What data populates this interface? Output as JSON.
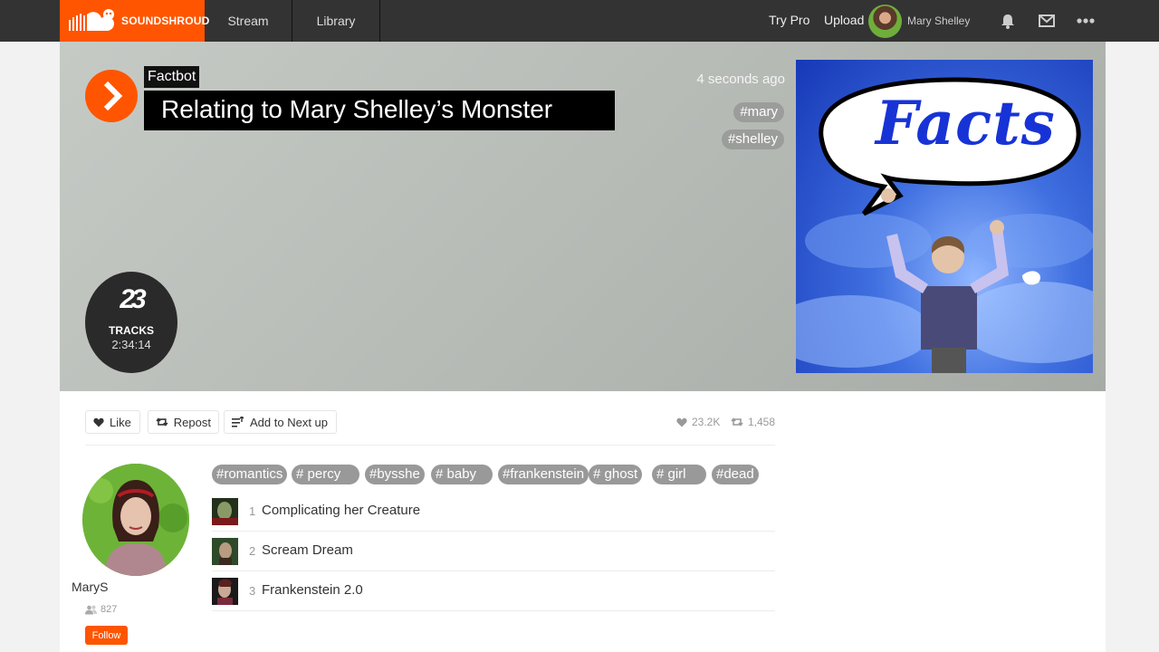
{
  "nav": {
    "logo_text": "SOUNDSHROUD",
    "tabs": [
      {
        "label": "Stream"
      },
      {
        "label": "Library"
      }
    ],
    "try_pro": "Try Pro",
    "upload": "Upload",
    "user_name": "Mary Shelley",
    "icons": [
      "bell-icon",
      "mail-icon",
      "more-icon"
    ],
    "accent": "#ff5500"
  },
  "hero": {
    "artist": "Factbot",
    "title": "Relating to Mary Shelley’s Monster",
    "time": "4 seconds ago",
    "tags": [
      "#mary",
      "#shelley"
    ],
    "artwork_text": "Facts",
    "tracks_count": "23",
    "tracks_label": "TRACKS",
    "duration": "2:34:14"
  },
  "actions": {
    "like": "Like",
    "repost": "Repost",
    "next_up": "Add to Next up",
    "likes_count": "23.2K",
    "reposts_count": "1,458"
  },
  "user": {
    "name": "MaryS",
    "followers": "827",
    "follow": "Follow"
  },
  "tags": [
    "#romantics",
    "# percy",
    "#bysshe",
    "# baby",
    "#frankenstein",
    "# ghost",
    "# girl",
    "#dead"
  ],
  "tracks": [
    {
      "num": "1",
      "title": "Complicating her Creature"
    },
    {
      "num": "2",
      "title": "Scream Dream"
    },
    {
      "num": "3",
      "title": "Frankenstein 2.0"
    }
  ]
}
